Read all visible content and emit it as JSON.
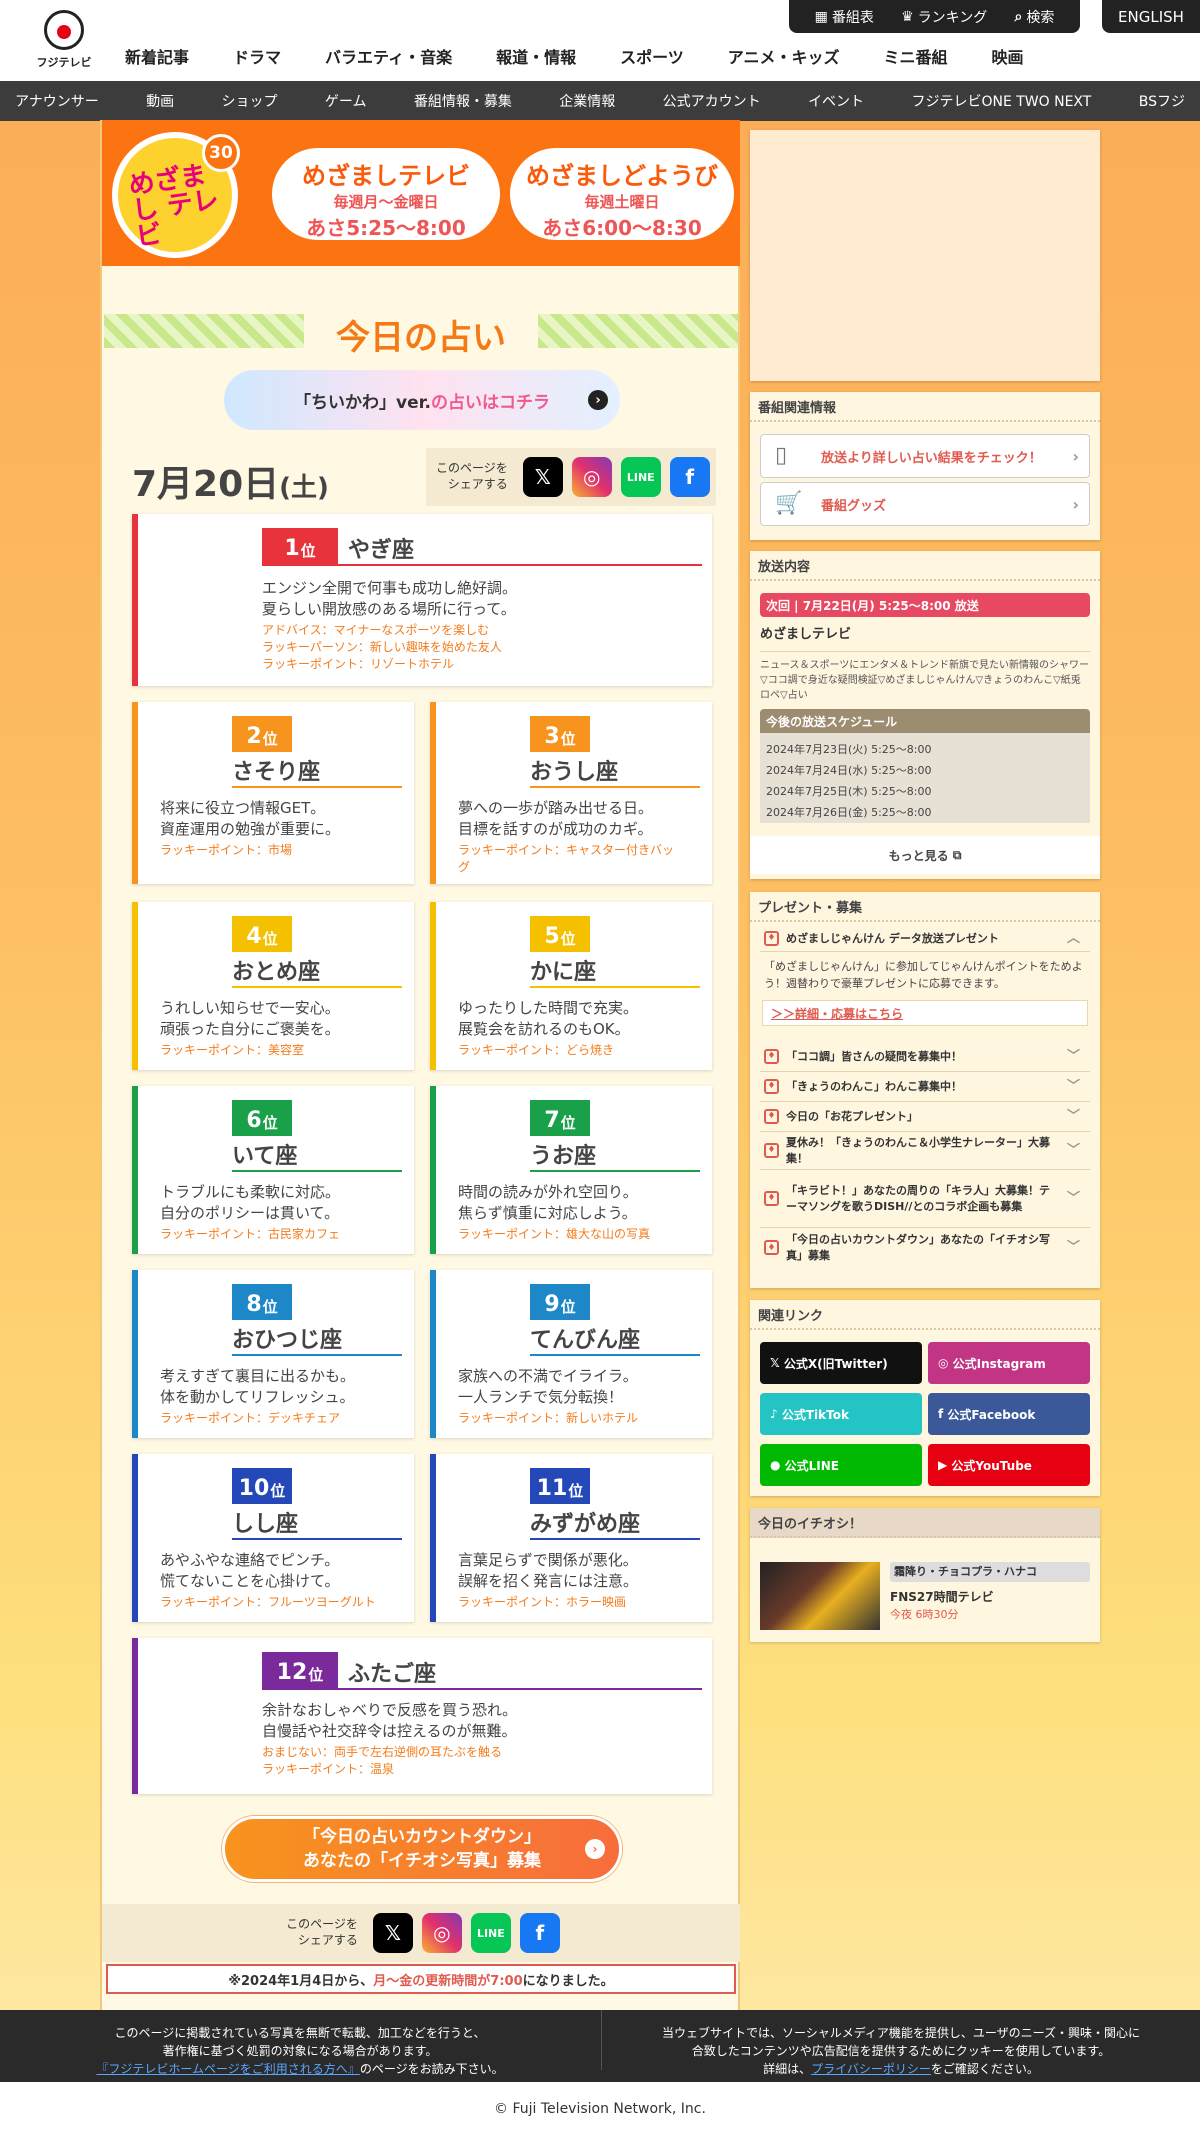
{
  "util": {
    "bangumi": "番組表",
    "ranking": "ランキング",
    "search": "検索",
    "english": "ENGLISH"
  },
  "logo": "フジテレビ",
  "gnav": [
    "新着記事",
    "ドラマ",
    "バラエティ・音楽",
    "報道・情報",
    "スポーツ",
    "アニメ・キッズ",
    "ミニ番組",
    "映画"
  ],
  "subnav": [
    "アナウンサー",
    "動画",
    "ショップ",
    "ゲーム",
    "番組情報・募集",
    "企業情報",
    "公式アカウント",
    "イベント",
    "フジテレビONE TWO NEXT",
    "BSフジ"
  ],
  "banner": {
    "logo_text": "めざまし テレビ",
    "logo_num": "30",
    "left": {
      "title": "めざましテレビ",
      "days": "毎週月～金曜日",
      "time": "あさ5:25～8:00"
    },
    "right": {
      "title": "めざましどようび",
      "days": "毎週土曜日",
      "time": "あさ6:00～8:30"
    }
  },
  "title": "今日の占い",
  "chiikawa": {
    "pre": "「ちいかわ」ver.",
    "link": "の占いはコチラ"
  },
  "date": {
    "md": "7月20日",
    "dow": "(土)"
  },
  "share_label": "このページを シェアする",
  "share_top": {
    "l1": "このページを",
    "l2": "シェアする"
  },
  "share": {
    "x": "𝕏",
    "ig": "◎",
    "line": "LINE",
    "fb": "f"
  },
  "ranks": [
    {
      "n": "1",
      "u": "位",
      "sign": "やぎ座",
      "t1": "エンジン全開で何事も成功し絶好調。",
      "t2": "夏らしい開放感のある場所に行って。",
      "l1": "アドバイス：マイナーなスポーツを楽しむ",
      "l2": "ラッキーパーソン：新しい趣味を始めた友人",
      "l3": "ラッキーポイント：リゾートホテル"
    },
    {
      "n": "2",
      "u": "位",
      "sign": "さそり座",
      "t1": "将来に役立つ情報GET。",
      "t2": "資産運用の勉強が重要に。",
      "l1": "ラッキーポイント：市場"
    },
    {
      "n": "3",
      "u": "位",
      "sign": "おうし座",
      "t1": "夢への一歩が踏み出せる日。",
      "t2": "目標を話すのが成功のカギ。",
      "l1": "ラッキーポイント：キャスター付きバッ",
      "l2": "グ"
    },
    {
      "n": "4",
      "u": "位",
      "sign": "おとめ座",
      "t1": "うれしい知らせで一安心。",
      "t2": "頑張った自分にご褒美を。",
      "l1": "ラッキーポイント：美容室"
    },
    {
      "n": "5",
      "u": "位",
      "sign": "かに座",
      "t1": "ゆったりした時間で充実。",
      "t2": "展覧会を訪れるのもOK。",
      "l1": "ラッキーポイント：どら焼き"
    },
    {
      "n": "6",
      "u": "位",
      "sign": "いて座",
      "t1": "トラブルにも柔軟に対応。",
      "t2": "自分のポリシーは貫いて。",
      "l1": "ラッキーポイント：古民家カフェ"
    },
    {
      "n": "7",
      "u": "位",
      "sign": "うお座",
      "t1": "時間の読みが外れ空回り。",
      "t2": "焦らず慎重に対応しよう。",
      "l1": "ラッキーポイント：雄大な山の写真"
    },
    {
      "n": "8",
      "u": "位",
      "sign": "おひつじ座",
      "t1": "考えすぎて裏目に出るかも。",
      "t2": "体を動かしてリフレッシュ。",
      "l1": "ラッキーポイント：デッキチェア"
    },
    {
      "n": "9",
      "u": "位",
      "sign": "てんびん座",
      "t1": "家族への不満でイライラ。",
      "t2": "一人ランチで気分転換！",
      "l1": "ラッキーポイント：新しいホテル"
    },
    {
      "n": "10",
      "u": "位",
      "sign": "しし座",
      "t1": "あやふやな連絡でピンチ。",
      "t2": "慌てないことを心掛けて。",
      "l1": "ラッキーポイント：フルーツヨーグルト"
    },
    {
      "n": "11",
      "u": "位",
      "sign": "みずがめ座",
      "t1": "言葉足らずで関係が悪化。",
      "t2": "誤解を招く発言には注意。",
      "l1": "ラッキーポイント：ホラー映画"
    },
    {
      "n": "12",
      "u": "位",
      "sign": "ふたご座",
      "t1": "余計なおしゃべりで反感を買う恐れ。",
      "t2": "自慢話や社交辞令は控えるのが無難。",
      "l1": "おまじない：両手で左右逆側の耳たぶを触る",
      "l2": "ラッキーポイント：温泉"
    }
  ],
  "rank_colors": [
    "#e8333c",
    "#f7941d",
    "#f7941d",
    "#f5c000",
    "#f5c000",
    "#1aa048",
    "#1aa048",
    "#1e87c8",
    "#1e87c8",
    "#2448b8",
    "#2448b8",
    "#7a2a9a"
  ],
  "countdown": {
    "l1": "「今日の占いカウントダウン」",
    "l2": "あなたの「イチオシ写真」募集"
  },
  "notice": {
    "pre": "※2024年1月4日から、",
    "red": "月～金の更新時間が7:00",
    "post": "になりました。"
  },
  "side": {
    "related_title": "番組関連情報",
    "rel1": "放送より詳しい占い結果をチェック！",
    "rel2": "番組グッズ",
    "onair_title": "放送内容",
    "next": "次回 | 7月22日(月) 5:25～8:00 放送",
    "prog": "めざましテレビ",
    "desc": "ニュース＆スポーツにエンタメ＆トレンド新旗で見たい新情報のシャワー▽ココ調で身近な疑問検証▽めざましじゃんけん▽きょうのわんこ▽紙兎ロペ▽占い",
    "sched_title": "今後の放送スケジュール",
    "sched": [
      "2024年7月23日(火) 5:25～8:00",
      "2024年7月24日(水) 5:25～8:00",
      "2024年7月25日(木) 5:25～8:00",
      "2024年7月26日(金) 5:25～8:00"
    ],
    "more": "もっと見る",
    "present_title": "プレゼント・募集",
    "p_open": "めざましじゃんけん データ放送プレゼント",
    "p_desc": "「めざましじゃんけん」に参加してじゃんけんポイントをためよう！週替わりで豪華プレゼントに応募できます。",
    "p_link": "＞＞詳細・応募はこちら",
    "p_items": [
      "「ココ調」皆さんの疑問を募集中！",
      "「きょうのわんこ」わんこ募集中！",
      "今日の「お花プレゼント」",
      "夏休み！「きょうのわんこ＆小学生ナレーター」大募集！",
      "「キラビト！」あなたの周りの「キラ人」大募集！テーマソングを歌うDISH//とのコラボ企画も募集",
      "「今日の占いカウントダウン」あなたの「イチオシ写真」募集"
    ],
    "links_title": "関連リンク",
    "links": [
      "公式X(旧Twitter)",
      "公式Instagram",
      "公式TikTok",
      "公式Facebook",
      "公式LINE",
      "公式YouTube"
    ],
    "link_colors": [
      "#111111",
      "#c13584",
      "#25c4c4",
      "#3b5998",
      "#00b900",
      "#e60012"
    ],
    "ichioshi_title": "今日のイチオシ！",
    "ichi_tag": "霜降り・チョコプラ・ハナコ",
    "ichi_name": "FNS27時間テレビ",
    "ichi_time": "今夜 6時30分"
  },
  "footer": {
    "l1": "このページに掲載されている写真を無断で転載、加工などを行うと、",
    "l2": "著作権に基づく処罰の対象になる場合があります。",
    "l3a": "『フジテレビホームページをご利用される方へ』",
    "l3b": "のページをお読み下さい。",
    "r1": "当ウェブサイトでは、ソーシャルメディア機能を提供し、ユーザのニーズ・興味・関心に",
    "r2": "合致したコンテンツや広告配信を提供するためにクッキーを使用しています。",
    "r3a": "詳細は、",
    "r3b": "プライバシーポリシー",
    "r3c": "をご確認ください。"
  },
  "copyright": "© Fuji Television Network, Inc."
}
